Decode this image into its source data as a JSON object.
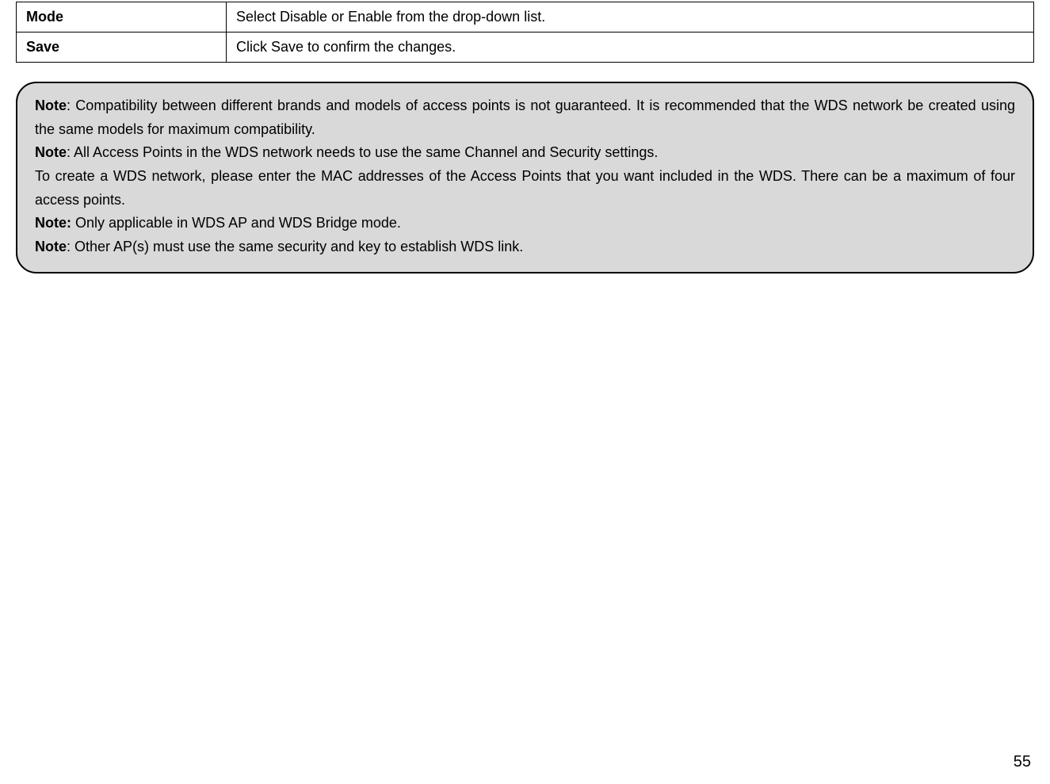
{
  "table": {
    "rows": [
      {
        "label": "Mode",
        "desc": "Select Disable or Enable from the drop-down list."
      },
      {
        "label": "Save",
        "desc": "Click Save to confirm the changes."
      }
    ]
  },
  "notes": {
    "label": "Note",
    "label_colon_strong": "Note:",
    "n1_text": ": Compatibility between different brands and models of access points is not guaranteed. It is recommended that the WDS network be created using the same models for maximum compatibility.",
    "n2_text": ": All Access Points in the WDS network needs to use the same Channel and Security settings.",
    "n3_text": "To create a WDS network, please enter the MAC addresses of the Access Points that you want included in the WDS. There can be a maximum of four access points.",
    "n4_text": " Only applicable in WDS AP and WDS Bridge mode.",
    "n5_text": ": Other AP(s) must use the same security and key to establish WDS link."
  },
  "page_number": "55"
}
